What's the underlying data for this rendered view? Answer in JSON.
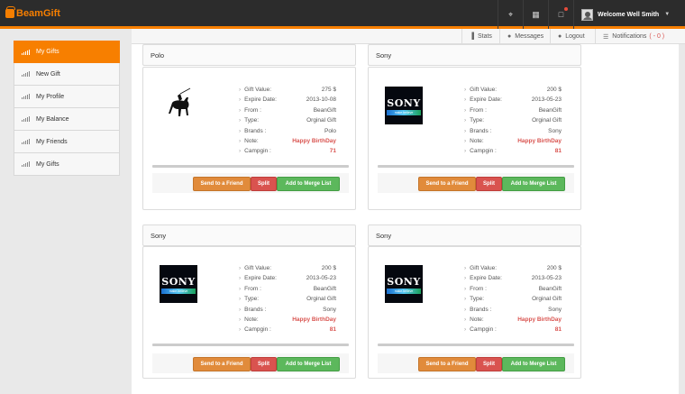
{
  "app": {
    "brand": "BeamGift"
  },
  "topbar": {
    "icons": [
      "fullscreen-icon",
      "grid-icon",
      "chat-icon"
    ],
    "user_name": "Welcome Well Smith"
  },
  "subnav": {
    "stats": "Stats",
    "messages": "Messages",
    "logout": "Logout",
    "notifications": "Notifications",
    "notifications_count": "( - 0 )"
  },
  "sidebar": {
    "items": [
      {
        "label": "My Gifts",
        "active": true
      },
      {
        "label": "New Gift"
      },
      {
        "label": "My Profile"
      },
      {
        "label": "My Balance"
      },
      {
        "label": "My Friends"
      },
      {
        "label": "My Gifts"
      }
    ]
  },
  "labels": {
    "gift_value": "Gift Value:",
    "expire_date": "Expire Date:",
    "from": "From :",
    "type": "Type:",
    "brands": "Brands :",
    "note": "Note:",
    "campgin": "Campgin :"
  },
  "buttons": {
    "send": "Send to a Friend",
    "split": "Split",
    "merge": "Add to Merge List"
  },
  "logos": {
    "sony_word": "SONY",
    "sony_tag": "make.believe"
  },
  "gifts": [
    {
      "title": "Polo",
      "value": "275 $",
      "expire": "2013-10-08",
      "from": "BeanGift",
      "type": "Orginal Gift",
      "brand": "Polo",
      "note": "Happy BirthDay",
      "campgin": "71",
      "logo": "polo"
    },
    {
      "title": "Sony",
      "value": "200 $",
      "expire": "2013-05-23",
      "from": "BeanGift",
      "type": "Orginal Gift",
      "brand": "Sony",
      "note": "Happy BirthDay",
      "campgin": "81",
      "logo": "sony"
    },
    {
      "title": "Sony",
      "value": "200 $",
      "expire": "2013-05-23",
      "from": "BeanGift",
      "type": "Orginal Gift",
      "brand": "Sony",
      "note": "Happy BirthDay",
      "campgin": "81",
      "logo": "sony"
    },
    {
      "title": "Sony",
      "value": "200 $",
      "expire": "2013-05-23",
      "from": "BeanGift",
      "type": "Orginal Gift",
      "brand": "Sony",
      "note": "Happy BirthDay",
      "campgin": "81",
      "logo": "sony"
    }
  ],
  "colors": {
    "accent": "#f77f00",
    "topbar": "#2c2c2c",
    "danger": "#d9534f",
    "success": "#5cb85c",
    "warning": "#e18b3b"
  }
}
